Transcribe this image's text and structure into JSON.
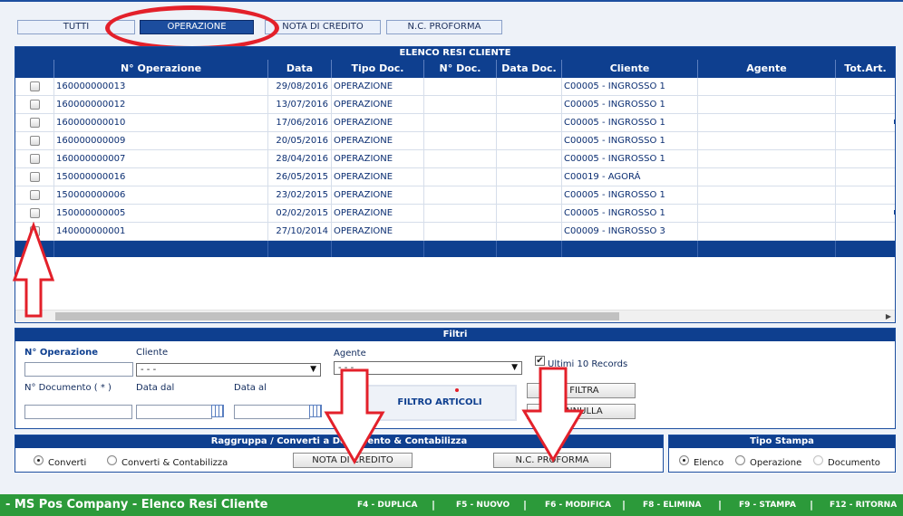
{
  "tabs": [
    {
      "label": "TUTTI",
      "active": false
    },
    {
      "label": "OPERAZIONE",
      "active": true
    },
    {
      "label": "NOTA DI CREDITO",
      "active": false
    },
    {
      "label": "N.C. PROFORMA",
      "active": false
    }
  ],
  "grid": {
    "title": "ELENCO RESI CLIENTE",
    "columns": [
      "",
      "N° Operazione",
      "Data",
      "Tipo Doc.",
      "N° Doc.",
      "Data Doc.",
      "Cliente",
      "Agente",
      "Tot.Art."
    ],
    "rows": [
      {
        "num": "160000000013",
        "data": "29/08/2016",
        "tipo": "OPERAZIONE",
        "ndoc": "",
        "datadoc": "",
        "cliente": "C00005 - INGROSSO 1",
        "agente": ""
      },
      {
        "num": "160000000012",
        "data": "13/07/2016",
        "tipo": "OPERAZIONE",
        "ndoc": "",
        "datadoc": "",
        "cliente": "C00005 - INGROSSO 1",
        "agente": ""
      },
      {
        "num": "160000000010",
        "data": "17/06/2016",
        "tipo": "OPERAZIONE",
        "ndoc": "",
        "datadoc": "",
        "cliente": "C00005 - INGROSSO 1",
        "agente": ""
      },
      {
        "num": "160000000009",
        "data": "20/05/2016",
        "tipo": "OPERAZIONE",
        "ndoc": "",
        "datadoc": "",
        "cliente": "C00005 - INGROSSO 1",
        "agente": ""
      },
      {
        "num": "160000000007",
        "data": "28/04/2016",
        "tipo": "OPERAZIONE",
        "ndoc": "",
        "datadoc": "",
        "cliente": "C00005 - INGROSSO 1",
        "agente": ""
      },
      {
        "num": "150000000016",
        "data": "26/05/2015",
        "tipo": "OPERAZIONE",
        "ndoc": "",
        "datadoc": "",
        "cliente": "C00019 - AGORÁ",
        "agente": ""
      },
      {
        "num": "150000000006",
        "data": "23/02/2015",
        "tipo": "OPERAZIONE",
        "ndoc": "",
        "datadoc": "",
        "cliente": "C00005 - INGROSSO 1",
        "agente": ""
      },
      {
        "num": "150000000005",
        "data": "02/02/2015",
        "tipo": "OPERAZIONE",
        "ndoc": "",
        "datadoc": "",
        "cliente": "C00005 - INGROSSO 1",
        "agente": ""
      },
      {
        "num": "140000000001",
        "data": "27/10/2014",
        "tipo": "OPERAZIONE",
        "ndoc": "",
        "datadoc": "",
        "cliente": "C00009 - INGROSSO 3",
        "agente": ""
      }
    ]
  },
  "filtri": {
    "title": "Filtri",
    "n_operazione_label": "N° Operazione",
    "cliente_label": "Cliente",
    "cliente_value": "- - -",
    "agente_label": "Agente",
    "agente_value": "- - -",
    "ultimi_label": "Ultimi 10 Records",
    "ultimi_checked": true,
    "n_documento_label": "N° Documento ( * )",
    "data_dal_label": "Data dal",
    "data_al_label": "Data al",
    "filtro_articoli_label": "FILTRO ARTICOLI",
    "filtra_label": "- FILTRA",
    "annulla_label": "ANNULLA"
  },
  "raggruppa": {
    "title": "Raggruppa / Converti a Documento & Contabilizza",
    "opt1": "Converti",
    "opt2": "Converti & Contabilizza",
    "btn_nota": "NOTA DI CREDITO",
    "btn_ncp": "N.C. PROFORMA"
  },
  "stampa": {
    "title": "Tipo Stampa",
    "opt1": "Elenco",
    "opt2": "Operazione",
    "opt3": "Documento"
  },
  "footer": {
    "title": "- MS Pos Company - Elenco Resi Cliente",
    "keys": [
      "F4 - DUPLICA",
      "F5 - NUOVO",
      "F6 - MODIFICA",
      "F8 - ELIMINA",
      "F9 - STAMPA",
      "F12 - RITORNA"
    ],
    "sep": "|"
  },
  "colors": {
    "primary": "#0e3f8f",
    "annotation": "#e3202a",
    "footer": "#2c9a3a"
  }
}
